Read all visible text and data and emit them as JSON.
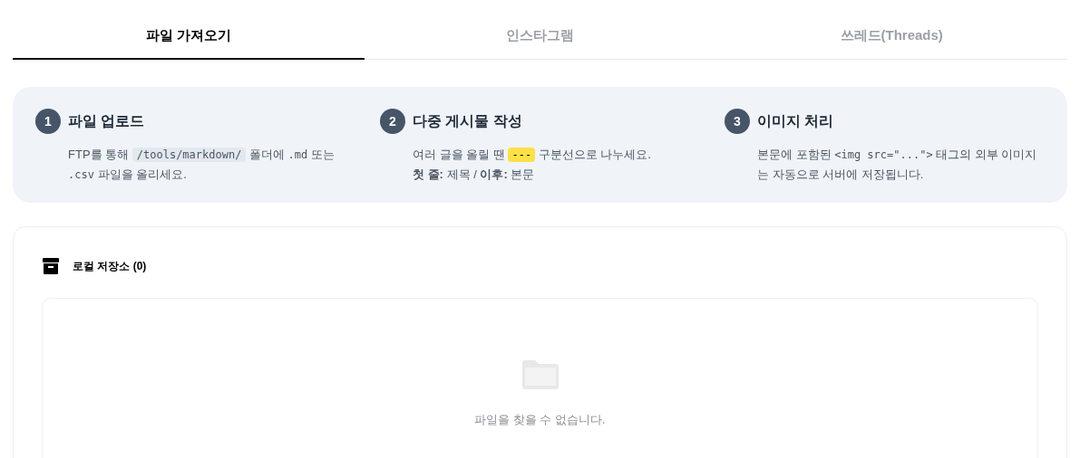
{
  "tabs": [
    {
      "label": "파일 가져오기",
      "selected": true
    },
    {
      "label": "인스타그램",
      "selected": false
    },
    {
      "label": "쓰레드(Threads)",
      "selected": false
    }
  ],
  "steps": [
    {
      "number": "1",
      "title": "파일 업로드",
      "lines": [
        [
          {
            "kind": "text",
            "text": "FTP를 통해 "
          },
          {
            "kind": "code",
            "text": "/tools/markdown/"
          },
          {
            "kind": "text",
            "text": " 폴더에 "
          },
          {
            "kind": "mono",
            "text": ".md"
          },
          {
            "kind": "text",
            "text": " 또는 "
          },
          {
            "kind": "mono",
            "text": ".csv"
          },
          {
            "kind": "text",
            "text": " 파일을 올리세요."
          }
        ]
      ]
    },
    {
      "number": "2",
      "title": "다중 게시물 작성",
      "lines": [
        [
          {
            "kind": "text",
            "text": "여러 글을 올릴 땐 "
          },
          {
            "kind": "mark",
            "text": "---"
          },
          {
            "kind": "text",
            "text": " 구분선으로 나누세요."
          }
        ],
        [
          {
            "kind": "text",
            "text": "**첫 줄:** 제목 / **이후:** 본문"
          }
        ]
      ]
    },
    {
      "number": "3",
      "title": "이미지 처리",
      "lines": [
        [
          {
            "kind": "text",
            "text": "본문에 포함된 "
          },
          {
            "kind": "mono",
            "text": "<img src=\"...\">"
          },
          {
            "kind": "text",
            "text": " 태그의 외부 이미지는 자동으로 서버에 저장됩니다."
          }
        ]
      ]
    }
  ],
  "storage": {
    "title": "로컬 저장소 (0)",
    "empty_message": "파일을 찾을 수 없습니다."
  }
}
